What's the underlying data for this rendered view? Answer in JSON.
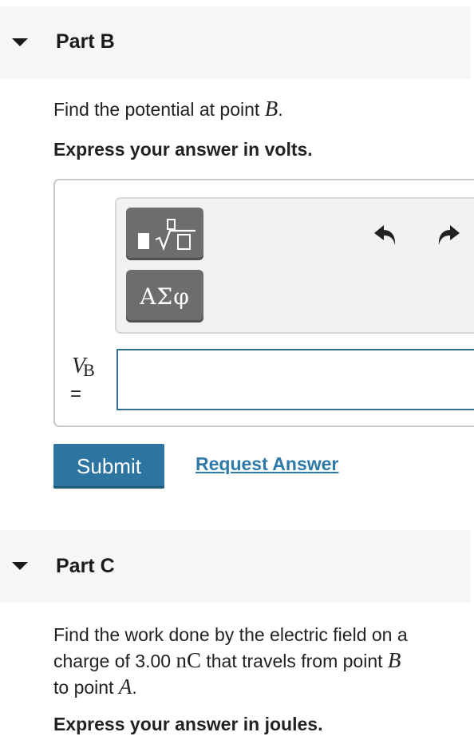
{
  "part_b": {
    "title": "Part B",
    "prompt_text": "Find the potential at point ",
    "prompt_var": "B",
    "prompt_end": ".",
    "instruction": "Express your answer in volts.",
    "toolbar": {
      "template_button_icon": "fraction-sqrt-template-icon",
      "greek_button_label": "ΑΣφ",
      "undo_icon": "undo-icon",
      "redo_icon": "redo-icon"
    },
    "variable": "V",
    "variable_sub": "B",
    "equals": "=",
    "answer_value": "",
    "submit_label": "Submit",
    "request_answer_label": "Request Answer"
  },
  "part_c": {
    "title": "Part C",
    "line1": "Find the work done by the electric field on a",
    "line2_a": "charge of 3.00 ",
    "line2_unit": "nC",
    "line2_b": " that travels from point ",
    "line2_var": "B",
    "line3_a": "to point ",
    "line3_var": "A",
    "line3_end": ".",
    "instruction": "Express your answer in joules."
  },
  "colors": {
    "header_bg": "#f6f6f6",
    "submit_bg": "#2d75a0",
    "link": "#2d7aa8",
    "tool_button": "#6d6d6d",
    "input_border": "#2e6e8e"
  }
}
